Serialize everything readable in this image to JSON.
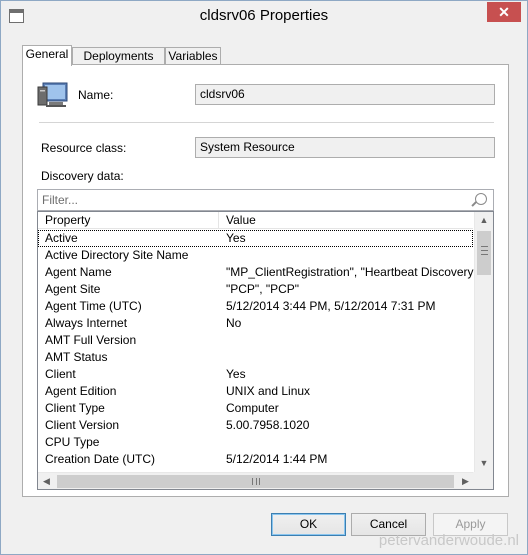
{
  "window": {
    "title": "cldsrv06 Properties",
    "close_glyph": "✕"
  },
  "tabs": [
    {
      "label": "General",
      "active": true
    },
    {
      "label": "Deployments",
      "active": false
    },
    {
      "label": "Variables",
      "active": false
    }
  ],
  "general": {
    "name_label": "Name:",
    "name_value": "cldsrv06",
    "resource_class_label": "Resource class:",
    "resource_class_value": "System Resource",
    "discovery_label": "Discovery data:",
    "filter_placeholder": "Filter..."
  },
  "discovery_table": {
    "columns": [
      "Property",
      "Value"
    ],
    "rows": [
      {
        "property": "Active",
        "value": "Yes"
      },
      {
        "property": "Active Directory Site Name",
        "value": ""
      },
      {
        "property": "Agent Name",
        "value": "\"MP_ClientRegistration\", \"Heartbeat Discovery\""
      },
      {
        "property": "Agent Site",
        "value": "\"PCP\", \"PCP\""
      },
      {
        "property": "Agent Time (UTC)",
        "value": "5/12/2014 3:44 PM, 5/12/2014 7:31 PM"
      },
      {
        "property": "Always Internet",
        "value": "No"
      },
      {
        "property": "AMT Full Version",
        "value": ""
      },
      {
        "property": "AMT Status",
        "value": ""
      },
      {
        "property": "Client",
        "value": "Yes"
      },
      {
        "property": "Agent Edition",
        "value": "UNIX and Linux"
      },
      {
        "property": "Client Type",
        "value": "Computer"
      },
      {
        "property": "Client Version",
        "value": "5.00.7958.1020"
      },
      {
        "property": "CPU Type",
        "value": ""
      },
      {
        "property": "Creation Date (UTC)",
        "value": "5/12/2014 1:44 PM"
      }
    ]
  },
  "buttons": {
    "ok": "OK",
    "cancel": "Cancel",
    "apply": "Apply"
  },
  "watermark": "petervanderwoude.nl",
  "icons": {
    "title": "window-icon",
    "computer": "computer-icon",
    "search": "search-icon"
  }
}
